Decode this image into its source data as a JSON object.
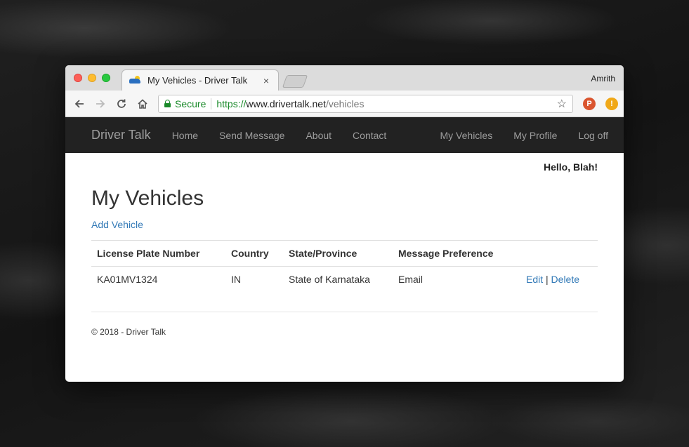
{
  "browser": {
    "tab_title": "My Vehicles - Driver Talk",
    "tab_close": "×",
    "profile_name": "Amrith",
    "secure_label": "Secure",
    "url_scheme": "https://",
    "url_host": "www.drivertalk.net",
    "url_path": "/vehicles",
    "ext_p_label": "P",
    "ext_warn_label": "!"
  },
  "navbar": {
    "brand": "Driver Talk",
    "left": [
      "Home",
      "Send Message",
      "About",
      "Contact"
    ],
    "right": [
      "My Vehicles",
      "My Profile",
      "Log off"
    ]
  },
  "page": {
    "greeting": "Hello, Blah!",
    "title": "My Vehicles",
    "add_link": "Add Vehicle"
  },
  "table": {
    "headers": [
      "License Plate Number",
      "Country",
      "State/Province",
      "Message Preference",
      ""
    ],
    "rows": [
      {
        "plate": "KA01MV1324",
        "country": "IN",
        "state": "State of Karnataka",
        "preference": "Email",
        "edit": "Edit",
        "separator": "|",
        "delete": "Delete"
      }
    ]
  },
  "footer": {
    "text": "© 2018 - Driver Talk"
  },
  "colors": {
    "navbar_bg": "#222222",
    "link": "#337ab7",
    "secure_green": "#1a8a2a"
  }
}
